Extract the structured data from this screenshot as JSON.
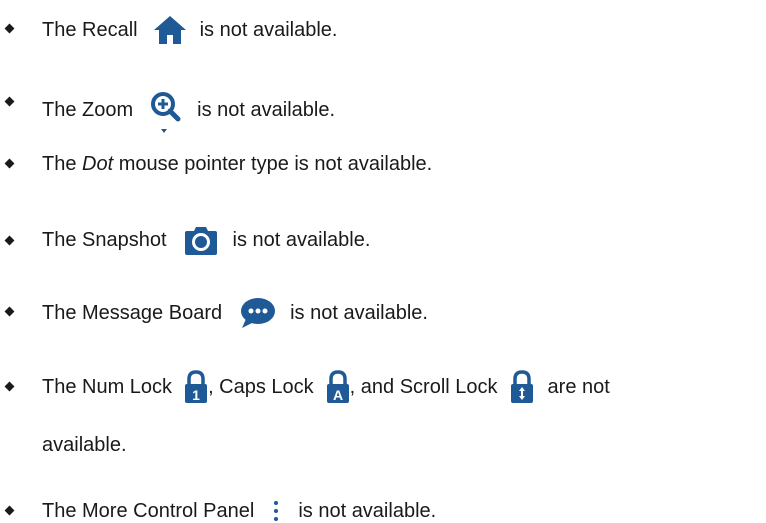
{
  "items": [
    {
      "pre": "The Recall",
      "post": "is not available.",
      "icon": "home-icon"
    },
    {
      "pre": "The Zoom",
      "post": "is not available.",
      "icon": "zoom-in-icon"
    },
    {
      "pre": "The ",
      "em": "Dot",
      "post": " mouse pointer type is not available."
    },
    {
      "pre": "The Snapshot",
      "post": "is not available.",
      "icon": "camera-icon"
    },
    {
      "pre": "The Message Board",
      "post": "is not available.",
      "icon": "chat-bubble-icon"
    },
    {
      "pre": "The Num Lock",
      "mid1": ", Caps Lock",
      "mid2": ", and Scroll Lock",
      "post": "are not",
      "line2": "available.",
      "icons": [
        "num-lock-icon",
        "caps-lock-icon",
        "scroll-lock-icon"
      ]
    },
    {
      "pre": "The More Control Panel",
      "post": "is not available.",
      "icon": "more-vertical-icon"
    }
  ],
  "colors": {
    "icon_blue": "#1f5a96",
    "text": "#1a1a1a"
  }
}
